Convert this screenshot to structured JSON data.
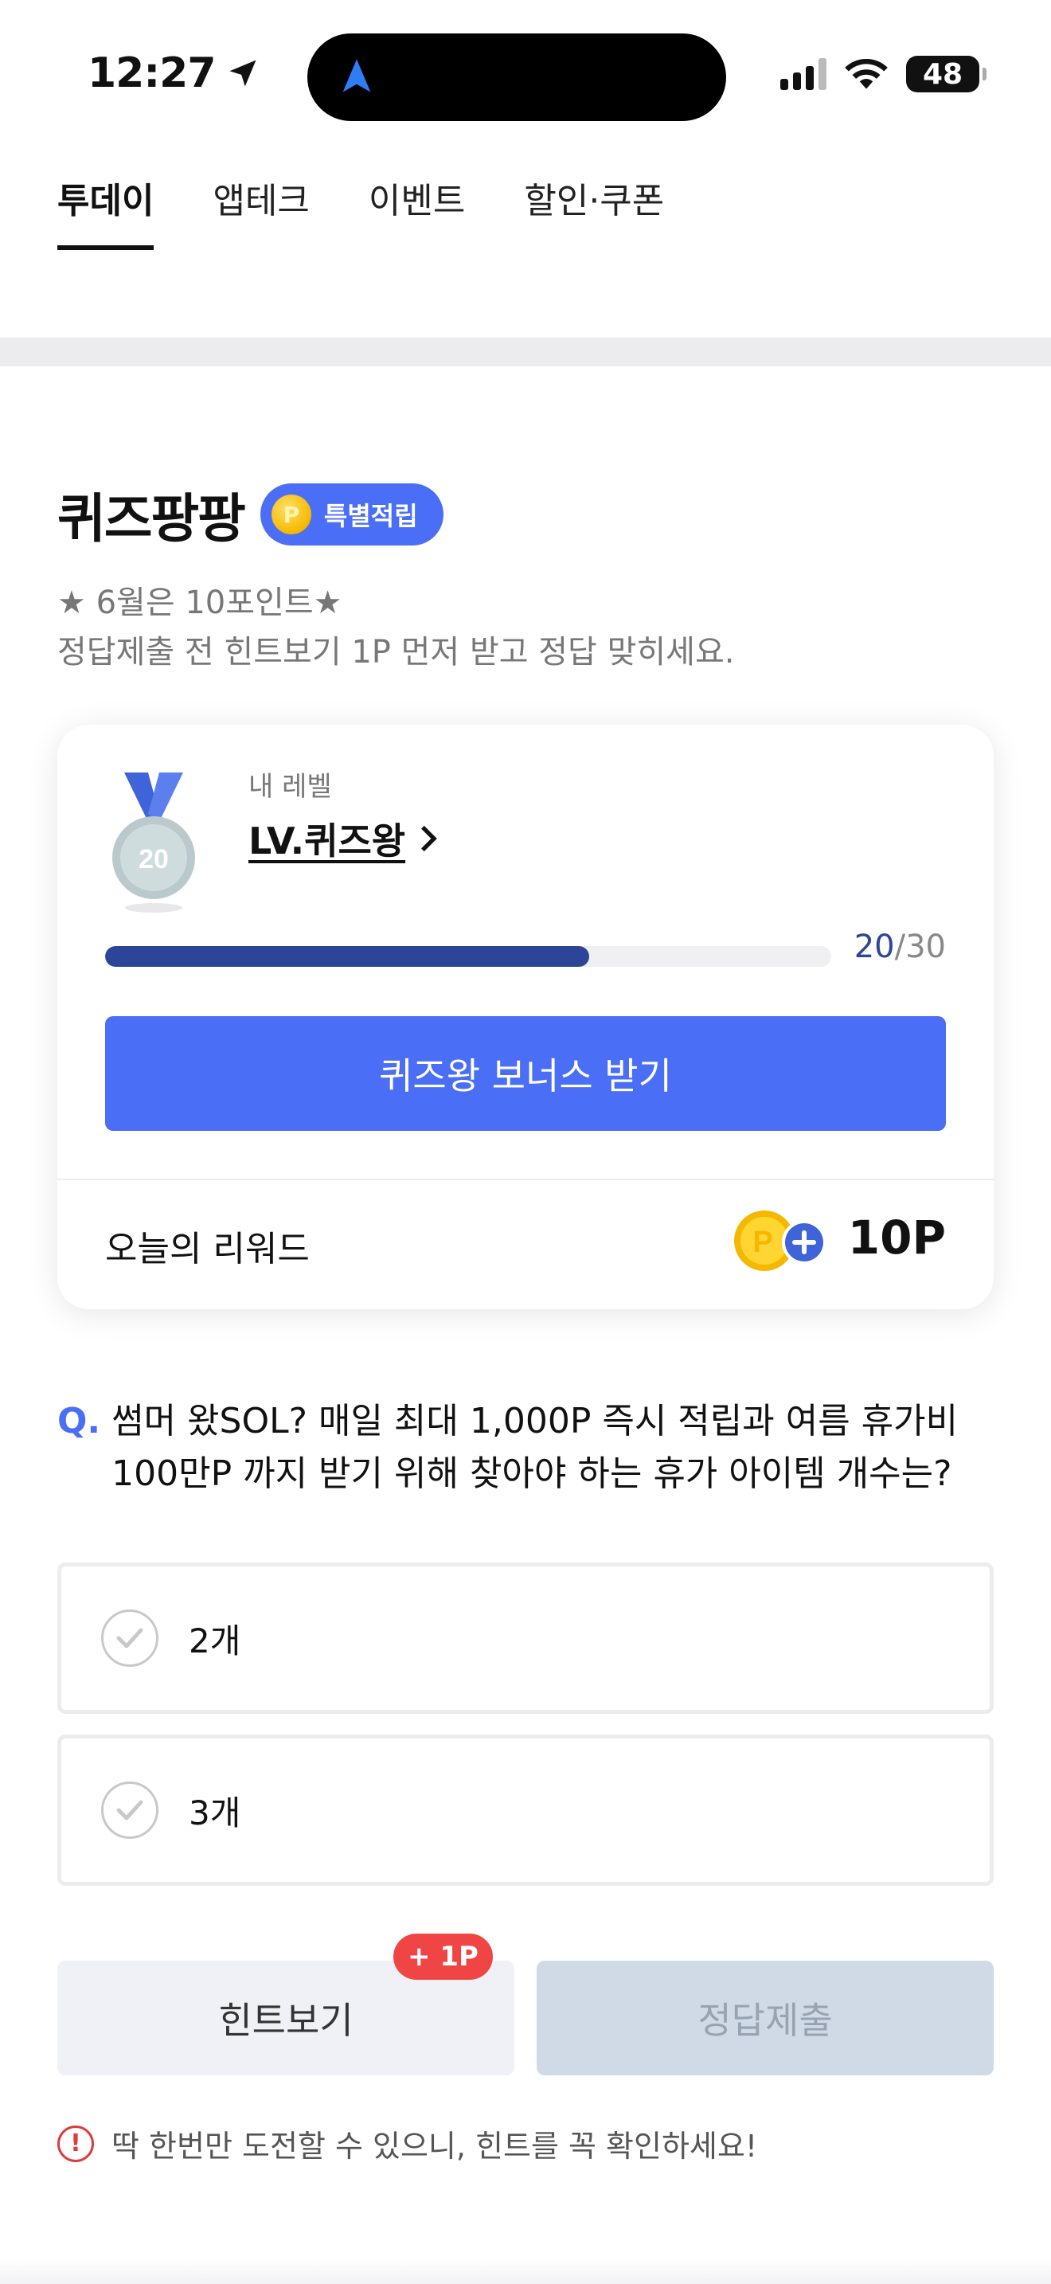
{
  "status_bar": {
    "time": "12:27",
    "battery": "48"
  },
  "tabs": [
    {
      "label": "투데이",
      "active": true
    },
    {
      "label": "앱테크",
      "active": false
    },
    {
      "label": "이벤트",
      "active": false
    },
    {
      "label": "할인·쿠폰",
      "active": false
    }
  ],
  "quiz": {
    "title": "퀴즈팡팡",
    "badge": "특별적립",
    "badge_coin": "P",
    "subtitle_line1": "★ 6월은 10포인트★",
    "subtitle_line2": "정답제출 전 힌트보기 1P 먼저 받고 정답 맞히세요."
  },
  "level_card": {
    "label": "내 레벨",
    "level_name": "LV.퀴즈왕",
    "medal_number": "20",
    "progress_current": "20",
    "progress_separator": "/",
    "progress_total": "30",
    "progress_fraction": 0.667,
    "bonus_button": "퀴즈왕 보너스 받기",
    "reward_label": "오늘의 리워드",
    "reward_value": "10P"
  },
  "question": {
    "prefix": "Q.",
    "text": "썸머 왔SOL? 매일 최대 1,000P 즉시 적립과 여름 휴가비 100만P 까지 받기 위해 찾아야 하는 휴가 아이템 개수는?"
  },
  "options": [
    {
      "label": "2개"
    },
    {
      "label": "3개"
    }
  ],
  "actions": {
    "hint_label": "힌트보기",
    "hint_badge": "+ 1P",
    "submit_label": "정답제출"
  },
  "warning": {
    "icon": "!",
    "text": "딱 한번만 도전할 수 있으니, 힌트를 꼭 확인하세요!"
  },
  "colors": {
    "accent": "#4a6ef5",
    "progress": "#2c4596",
    "badge_red": "#f04545",
    "disabled": "#d0dae6"
  }
}
